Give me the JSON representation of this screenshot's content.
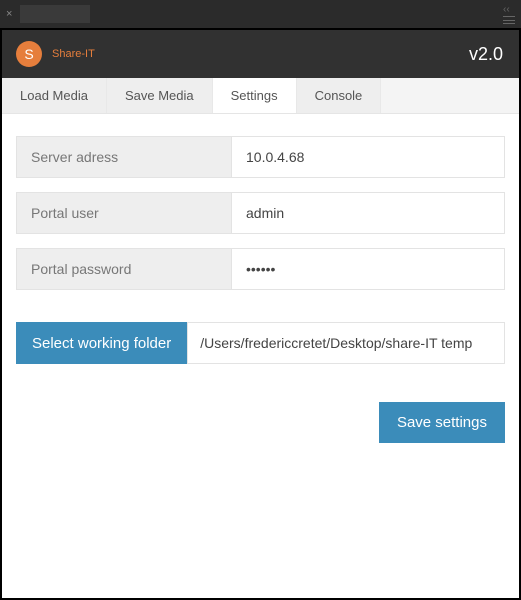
{
  "app": {
    "badge_letter": "S",
    "name": "Share-IT",
    "version": "v2.0"
  },
  "tabs": {
    "load_media": "Load Media",
    "save_media": "Save Media",
    "settings": "Settings",
    "console": "Console"
  },
  "settings": {
    "server_label": "Server adress",
    "server_value": "10.0.4.68",
    "user_label": "Portal user",
    "user_value": "admin",
    "password_label": "Portal password",
    "password_value": "••••••",
    "folder_btn": "Select working folder",
    "folder_path": "/Users/fredericcretet/Desktop/share-IT temp",
    "save_btn": "Save settings"
  }
}
